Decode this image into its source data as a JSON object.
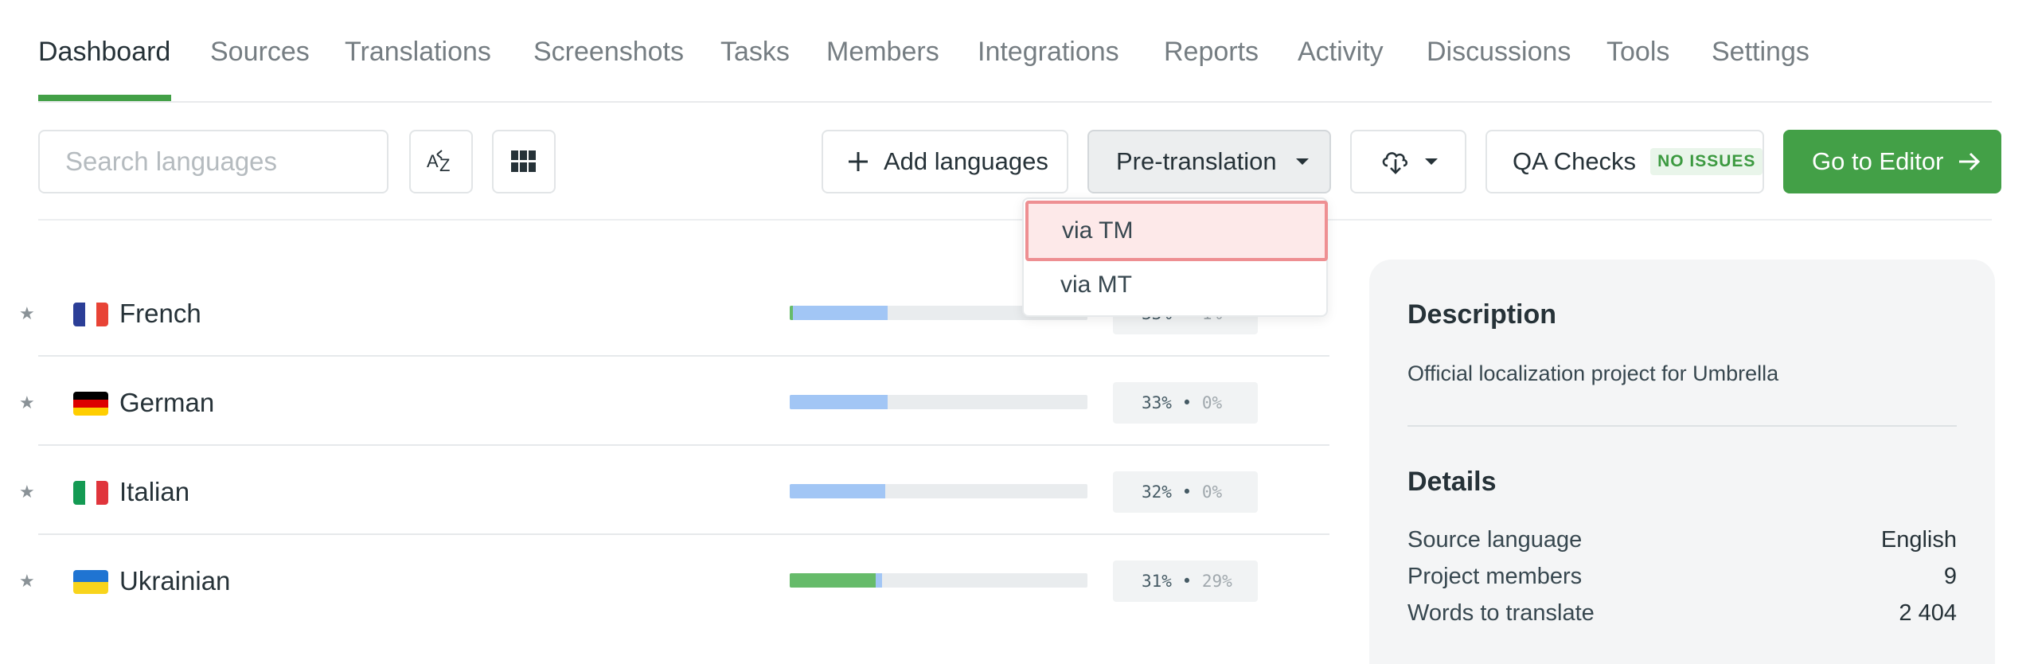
{
  "tabs": [
    "Dashboard",
    "Sources",
    "Translations",
    "Screenshots",
    "Tasks",
    "Members",
    "Integrations",
    "Reports",
    "Activity",
    "Discussions",
    "Tools",
    "Settings"
  ],
  "active_tab": "Dashboard",
  "toolbar": {
    "search_placeholder": "Search languages",
    "add_languages_label": "Add languages",
    "pretranslation_label": "Pre-translation",
    "qa_checks_label": "QA Checks",
    "qa_badge": "NO ISSUES",
    "go_to_editor_label": "Go to Editor",
    "sort_icon": "sort-az-icon",
    "grid_icon": "grid-view-icon",
    "download_icon": "cloud-download-icon"
  },
  "pretranslation_menu": {
    "items": [
      "via TM",
      "via MT"
    ],
    "highlighted": "via TM"
  },
  "languages": [
    {
      "name": "French",
      "flag": [
        "#2b3e97",
        "#ffffff",
        "#e84336"
      ],
      "translated_pct": 33,
      "approved_pct": 1,
      "progress_label": "33%",
      "approved_label": "1%"
    },
    {
      "name": "German",
      "flag": [
        "#000000",
        "#dd0000",
        "#ffce00"
      ],
      "translated_pct": 33,
      "approved_pct": 0,
      "progress_label": "33%",
      "approved_label": "0%"
    },
    {
      "name": "Italian",
      "flag": [
        "#149a53",
        "#ffffff",
        "#e0353c"
      ],
      "translated_pct": 32,
      "approved_pct": 0,
      "progress_label": "32%",
      "approved_label": "0%"
    },
    {
      "name": "Ukrainian",
      "flag": [
        "#1f74d2",
        "#f8d41c"
      ],
      "translated_pct": 31,
      "approved_pct": 29,
      "progress_label": "31%",
      "approved_label": "29%"
    }
  ],
  "panel": {
    "description_title": "Description",
    "description_text": "Official localization project for Umbrella",
    "details_title": "Details",
    "details": [
      {
        "label": "Source language",
        "value": "English"
      },
      {
        "label": "Project members",
        "value": "9"
      },
      {
        "label": "Words to translate",
        "value": "2 404"
      }
    ]
  },
  "colors": {
    "accent_green": "#43a047",
    "progress_blue": "#a2c6f5",
    "progress_green": "#66bb6a",
    "highlight_red": "#ee8f92"
  }
}
